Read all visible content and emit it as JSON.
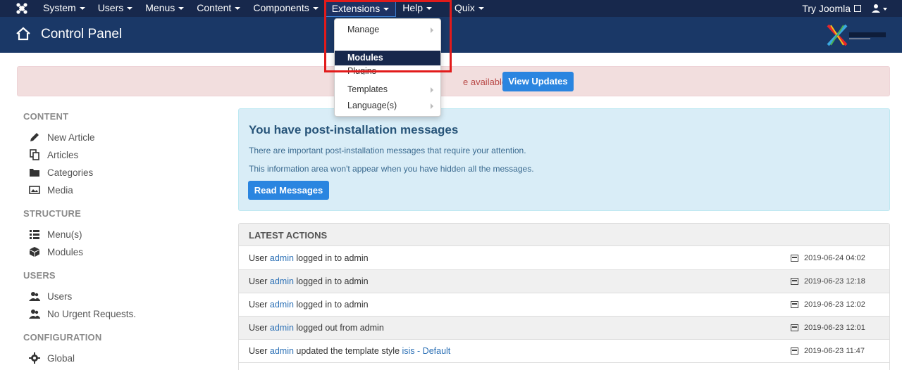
{
  "topbar": {
    "menu": [
      {
        "label": "System"
      },
      {
        "label": "Users"
      },
      {
        "label": "Menus"
      },
      {
        "label": "Content"
      },
      {
        "label": "Components"
      },
      {
        "label": "Extensions"
      },
      {
        "label": "Help"
      },
      {
        "label": "Quix"
      }
    ],
    "try_joomla": "Try Joomla"
  },
  "header": {
    "title": "Control Panel"
  },
  "alert": {
    "text_fragment": "e available:",
    "button": "View Updates"
  },
  "dropdown": {
    "items": [
      {
        "label": "Manage",
        "has_submenu": true
      },
      {
        "label": "Modules",
        "highlighted": true
      },
      {
        "label": "Plugins"
      },
      {
        "label": "Templates",
        "has_submenu": true
      },
      {
        "label": "Language(s)",
        "has_submenu": true
      }
    ]
  },
  "sidebar": {
    "sections": [
      {
        "title": "CONTENT",
        "items": [
          {
            "label": "New Article",
            "icon": "pencil-icon"
          },
          {
            "label": "Articles",
            "icon": "copy-icon"
          },
          {
            "label": "Categories",
            "icon": "folder-icon"
          },
          {
            "label": "Media",
            "icon": "image-icon"
          }
        ]
      },
      {
        "title": "STRUCTURE",
        "items": [
          {
            "label": "Menu(s)",
            "icon": "list-icon"
          },
          {
            "label": "Modules",
            "icon": "cube-icon"
          }
        ]
      },
      {
        "title": "USERS",
        "items": [
          {
            "label": "Users",
            "icon": "users-icon"
          },
          {
            "label": "No Urgent Requests.",
            "icon": "users-icon"
          }
        ]
      },
      {
        "title": "CONFIGURATION",
        "items": [
          {
            "label": "Global",
            "icon": "gear-icon"
          }
        ]
      }
    ]
  },
  "postinstall": {
    "title": "You have post-installation messages",
    "p1": "There are important post-installation messages that require your attention.",
    "p2": "This information area won't appear when you have hidden all the messages.",
    "button": "Read Messages"
  },
  "latest": {
    "title": "LATEST ACTIONS",
    "rows": [
      {
        "pre": "User ",
        "link": "admin",
        "post": " logged in to admin",
        "link2": "",
        "date": "2019-06-24 04:02"
      },
      {
        "pre": "User ",
        "link": "admin",
        "post": " logged in to admin",
        "link2": "",
        "date": "2019-06-23 12:18"
      },
      {
        "pre": "User ",
        "link": "admin",
        "post": " logged in to admin",
        "link2": "",
        "date": "2019-06-23 12:02"
      },
      {
        "pre": "User ",
        "link": "admin",
        "post": " logged out from admin",
        "link2": "",
        "date": "2019-06-23 12:01"
      },
      {
        "pre": "User ",
        "link": "admin",
        "post": " updated the template style ",
        "link2": "isis - Default",
        "date": "2019-06-23 11:47"
      }
    ]
  },
  "colors": {
    "topbar": "#17284c",
    "header": "#1a3867",
    "primary_button": "#2a85e0",
    "highlight_box": "#e21b1b"
  }
}
